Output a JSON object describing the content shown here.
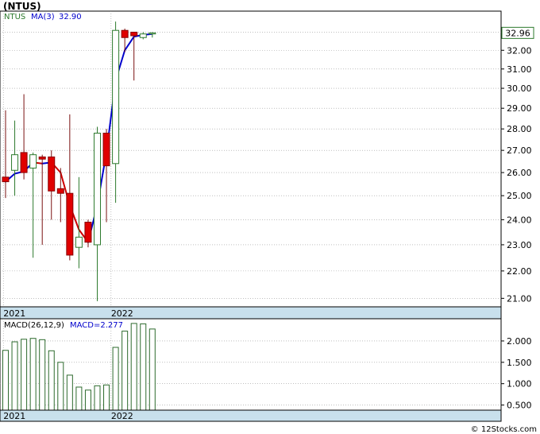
{
  "header": {
    "title": "(NTUS)"
  },
  "footer": {
    "credit": "© 12Stocks.com"
  },
  "colors": {
    "up_candle": "#2d7a2d",
    "down_candle": "#e00000",
    "ma_rising": "#0000cc",
    "ma_falling": "#cc0000",
    "axis_band": "#c8e0ec",
    "grid": "#999999",
    "macd_bar": "#2d6a2d"
  },
  "chart_data": [
    {
      "type": "candlestick",
      "ticker": "NTUS",
      "legend": {
        "symbol": "NTUS",
        "ma_label": "MA(3)",
        "ma_value": "32.90"
      },
      "last_price_label": "32.96",
      "ylim": [
        20.7,
        34.2
      ],
      "y_scale": "log",
      "yticks": [
        "21.00",
        "22.00",
        "23.00",
        "24.00",
        "25.00",
        "26.00",
        "27.00",
        "28.00",
        "29.00",
        "30.00",
        "31.00",
        "32.00",
        "33.00"
      ],
      "x_labels": [
        {
          "label": "2021",
          "index": 0
        },
        {
          "label": "2022",
          "index": 12
        }
      ],
      "candles": [
        {
          "o": 25.8,
          "h": 28.9,
          "l": 24.9,
          "c": 25.6
        },
        {
          "o": 26.1,
          "h": 28.4,
          "l": 25.0,
          "c": 26.8
        },
        {
          "o": 26.9,
          "h": 29.7,
          "l": 25.7,
          "c": 26.0
        },
        {
          "o": 26.2,
          "h": 26.9,
          "l": 22.5,
          "c": 26.8
        },
        {
          "o": 26.7,
          "h": 26.8,
          "l": 23.0,
          "c": 26.6
        },
        {
          "o": 26.7,
          "h": 27.0,
          "l": 24.0,
          "c": 25.2
        },
        {
          "o": 25.3,
          "h": 26.2,
          "l": 23.9,
          "c": 25.1
        },
        {
          "o": 25.1,
          "h": 28.7,
          "l": 22.4,
          "c": 22.6
        },
        {
          "o": 22.9,
          "h": 25.8,
          "l": 22.1,
          "c": 23.3
        },
        {
          "o": 23.9,
          "h": 24.0,
          "l": 22.9,
          "c": 23.1
        },
        {
          "o": 23.0,
          "h": 28.1,
          "l": 20.9,
          "c": 27.8
        },
        {
          "o": 27.8,
          "h": 28.0,
          "l": 23.9,
          "c": 26.3
        },
        {
          "o": 26.4,
          "h": 33.6,
          "l": 24.7,
          "c": 33.1
        },
        {
          "o": 33.1,
          "h": 33.2,
          "l": 31.9,
          "c": 32.7
        },
        {
          "o": 33.0,
          "h": 33.0,
          "l": 30.4,
          "c": 32.8
        },
        {
          "o": 32.7,
          "h": 33.0,
          "l": 32.6,
          "c": 32.9
        },
        {
          "o": 32.9,
          "h": 33.0,
          "l": 32.7,
          "c": 32.96
        }
      ],
      "ma": [
        25.6,
        25.95,
        26.05,
        26.45,
        26.4,
        26.45,
        26.0,
        24.6,
        23.6,
        23.1,
        24.6,
        26.9,
        30.4,
        32.0,
        32.75,
        32.85,
        32.9
      ]
    },
    {
      "type": "bar",
      "title": "MACD(26,12,9)",
      "value_label": "MACD=2.277",
      "ylim": [
        0.38,
        2.52
      ],
      "yticks": [
        "0.500",
        "1.000",
        "1.500",
        "2.000"
      ],
      "x_labels": [
        {
          "label": "2021",
          "index": 0
        },
        {
          "label": "2022",
          "index": 12
        }
      ],
      "values": [
        1.78,
        1.98,
        2.04,
        2.06,
        2.03,
        1.77,
        1.5,
        1.2,
        0.92,
        0.85,
        0.95,
        0.97,
        1.85,
        2.23,
        2.41,
        2.4,
        2.28
      ]
    }
  ]
}
